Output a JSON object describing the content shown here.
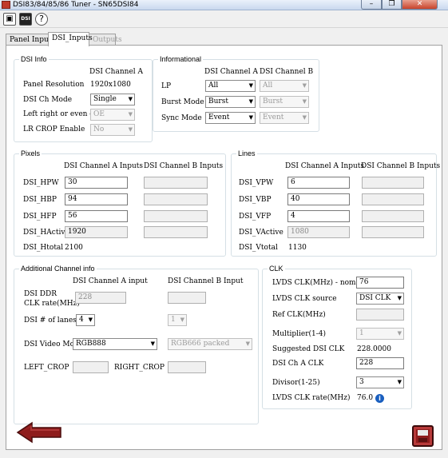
{
  "window": {
    "title": "DSI83/84/85/86 Tuner - SN65DSI84",
    "min": "–",
    "max": "❐",
    "close": "✕"
  },
  "toolbar": {
    "btn1": "▣",
    "btn2": "DSI",
    "help": "?"
  },
  "tabs": [
    "Panel Inputs",
    "DSI_Inputs",
    "Outputs"
  ],
  "dsi_info": {
    "title": "DSI Info",
    "col_a": "DSI Channel A",
    "panel_res_label": "Panel Resolution",
    "panel_res": "1920x1080",
    "ch_mode_label": "DSI Ch Mode",
    "ch_mode": "Single",
    "lr_label": "Left right or even odd",
    "lr": "OE",
    "crop_label": "LR CROP Enable",
    "crop": "No"
  },
  "informational": {
    "title": "Informational",
    "col_a": "DSI Channel A",
    "col_b": "DSI Channel B",
    "lp_label": "LP",
    "lp_a": "All",
    "lp_b": "All",
    "burst_label": "Burst Mode",
    "burst_a": "Burst",
    "burst_b": "Burst",
    "sync_label": "Sync Mode",
    "sync_a": "Event",
    "sync_b": "Event"
  },
  "pixels": {
    "title": "Pixels",
    "col_a": "DSI Channel A Inputs",
    "col_b": "DSI Channel B Inputs",
    "hpw_label": "DSI_HPW",
    "hpw": "30",
    "hbp_label": "DSI_HBP",
    "hbp": "94",
    "hfp_label": "DSI_HFP",
    "hfp": "56",
    "hactive_label": "DSI_HActive",
    "hactive": "1920",
    "htotal_label": "DSI_Htotal",
    "htotal": "2100"
  },
  "lines": {
    "title": "Lines",
    "col_a": "DSI Channel A Inputs",
    "col_b": "DSI Channel B Inputs",
    "vpw_label": "DSI_VPW",
    "vpw": "6",
    "vbp_label": "DSI_VBP",
    "vbp": "40",
    "vfp_label": "DSI_VFP",
    "vfp": "4",
    "vactive_label": "DSI_VActive",
    "vactive": "1080",
    "vtotal_label": "DSI_Vtotal",
    "vtotal": "1130"
  },
  "additional": {
    "title": "Additional Channel info",
    "col_a": "DSI Channel A input",
    "col_b": "DSI Channel B Input",
    "ddr_label_1": "DSI DDR",
    "ddr_label_2": "CLK rate(MHz)",
    "ddr_a": "228",
    "lanes_label": "DSI # of lanes",
    "lanes_a": "4",
    "lanes_b": "1",
    "video_label": "DSI Video Mode",
    "video_a": "RGB888",
    "video_b": "RGB666 packed",
    "left_crop_label": "LEFT_CROP",
    "right_crop_label": "RIGHT_CROP"
  },
  "clk": {
    "title": "CLK",
    "lvds_nom_label": "LVDS CLK(MHz) - nominal",
    "lvds_nom": "76",
    "lvds_src_label": "LVDS CLK source",
    "lvds_src": "DSI CLK",
    "ref_label": "Ref CLK(MHz)",
    "mult_label": "Multiplier(1-4)",
    "mult": "1",
    "sugg_label": "Suggested DSI CLK",
    "sugg": "228.0000",
    "cha_label": "DSI Ch A CLK",
    "cha": "228",
    "div_label": "Divisor(1-25)",
    "div": "3",
    "rate_label": "LVDS CLK rate(MHz)",
    "rate": "76.0"
  },
  "colors": {
    "accent_red": "#8e1c1c",
    "info_blue": "#1a5fbf"
  }
}
